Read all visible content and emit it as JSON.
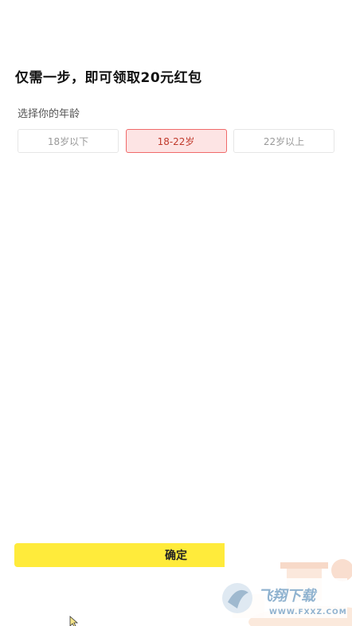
{
  "header": {
    "title": "仅需一步，即可领取20元红包"
  },
  "age_section": {
    "label": "选择你的年龄",
    "options": [
      {
        "label": "18岁以下",
        "selected": false
      },
      {
        "label": "18-22岁",
        "selected": true
      },
      {
        "label": "22岁以上",
        "selected": false
      }
    ]
  },
  "footer": {
    "confirm_label": "确定"
  },
  "watermark": {
    "brand_text": "飞翔下载",
    "url_text": "WWW.FXXZ.COM"
  },
  "colors": {
    "accent_yellow": "#ffeb3b",
    "selected_border": "#f06a6a",
    "selected_bg": "#fde4e4",
    "selected_text": "#c0392b"
  }
}
